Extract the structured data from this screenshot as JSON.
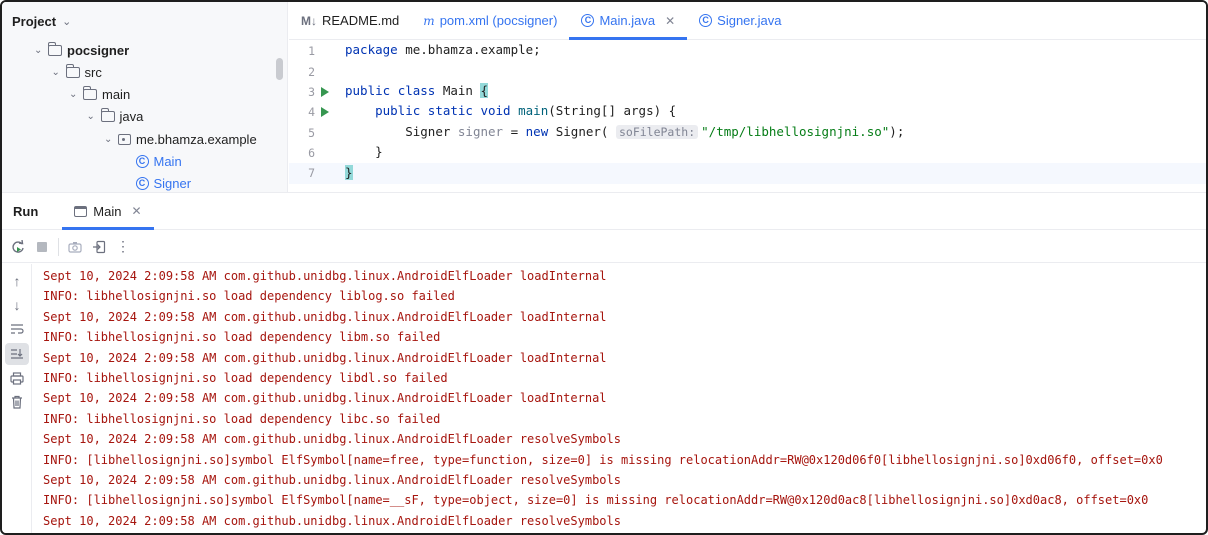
{
  "project": {
    "title": "Project",
    "tree": [
      {
        "label": "pocsigner",
        "type": "folder",
        "indent": 0,
        "bold": true
      },
      {
        "label": "src",
        "type": "folder",
        "indent": 1
      },
      {
        "label": "main",
        "type": "folder",
        "indent": 2
      },
      {
        "label": "java",
        "type": "folder",
        "indent": 3
      },
      {
        "label": "me.bhamza.example",
        "type": "package",
        "indent": 4
      },
      {
        "label": "Main",
        "type": "class",
        "indent": 5
      },
      {
        "label": "Signer",
        "type": "class",
        "indent": 5
      }
    ]
  },
  "tabs": [
    {
      "label": "README.md",
      "icon": "markdown-icon"
    },
    {
      "label": "pom.xml (pocsigner)",
      "icon": "maven-icon"
    },
    {
      "label": "Main.java",
      "icon": "class-icon",
      "active": true
    },
    {
      "label": "Signer.java",
      "icon": "class-icon"
    }
  ],
  "editor": {
    "line_numbers": [
      "1",
      "2",
      "3",
      "4",
      "5",
      "6",
      "7"
    ],
    "package_kw": "package",
    "package_name": " me.bhamza.example;",
    "l3_public": "public",
    "l3_class": "class",
    "l3_name": " Main ",
    "l3_brace": "{",
    "l4_indent": "    ",
    "l4_public": "public",
    "l4_static": "static",
    "l4_void": "void",
    "l4_main": "main",
    "l4_rest": "(String[] args) {",
    "l5_indent": "        ",
    "l5_type": "Signer ",
    "l5_var": "signer",
    "l5_eq": " = ",
    "l5_new": "new",
    "l5_ctor": " Signer(",
    "l5_hint": "soFilePath:",
    "l5_str": "\"/tmp/libhellosignjni.so\"",
    "l5_end": ");",
    "l6": "    }",
    "l7": "}"
  },
  "run": {
    "title": "Run",
    "tab_label": "Main"
  },
  "console": {
    "lines": [
      "Sept 10, 2024 2:09:58 AM com.github.unidbg.linux.AndroidElfLoader loadInternal",
      "INFO: libhellosignjni.so load dependency liblog.so failed",
      "Sept 10, 2024 2:09:58 AM com.github.unidbg.linux.AndroidElfLoader loadInternal",
      "INFO: libhellosignjni.so load dependency libm.so failed",
      "Sept 10, 2024 2:09:58 AM com.github.unidbg.linux.AndroidElfLoader loadInternal",
      "INFO: libhellosignjni.so load dependency libdl.so failed",
      "Sept 10, 2024 2:09:58 AM com.github.unidbg.linux.AndroidElfLoader loadInternal",
      "INFO: libhellosignjni.so load dependency libc.so failed",
      "Sept 10, 2024 2:09:58 AM com.github.unidbg.linux.AndroidElfLoader resolveSymbols",
      "INFO: [libhellosignjni.so]symbol ElfSymbol[name=free, type=function, size=0] is missing relocationAddr=RW@0x120d06f0[libhellosignjni.so]0xd06f0, offset=0x0",
      "Sept 10, 2024 2:09:58 AM com.github.unidbg.linux.AndroidElfLoader resolveSymbols",
      "INFO: [libhellosignjni.so]symbol ElfSymbol[name=__sF, type=object, size=0] is missing relocationAddr=RW@0x120d0ac8[libhellosignjni.so]0xd0ac8, offset=0x0",
      "Sept 10, 2024 2:09:58 AM com.github.unidbg.linux.AndroidElfLoader resolveSymbols"
    ]
  },
  "colors": {
    "accent": "#3574f0",
    "run_green": "#369650",
    "console_text": "#a6150e",
    "keyword": "#0033b3",
    "string": "#067d17"
  }
}
